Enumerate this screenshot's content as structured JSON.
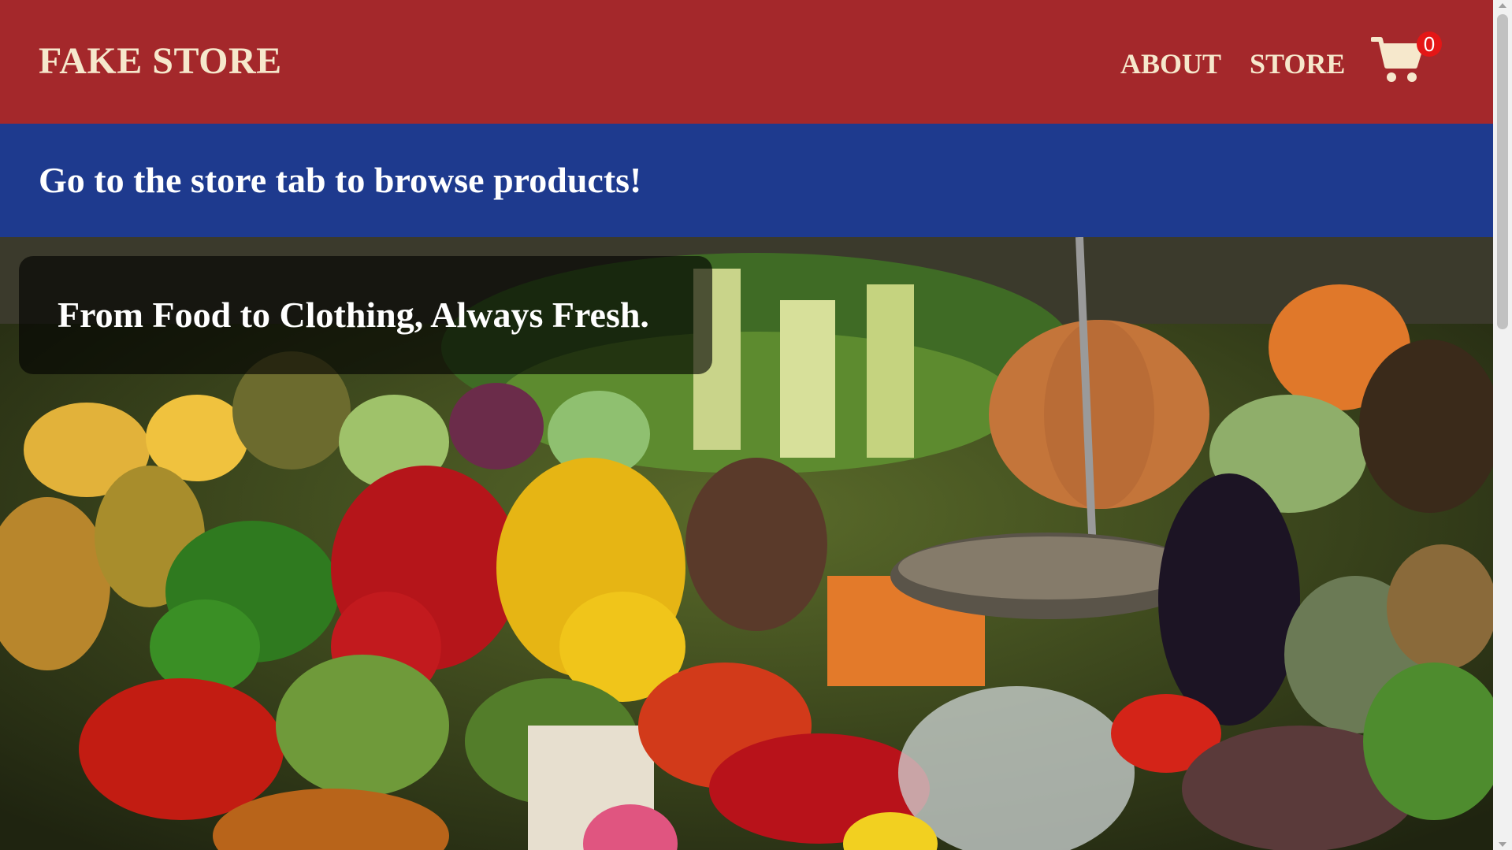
{
  "header": {
    "brand": "FAKE STORE",
    "nav": {
      "about_label": "ABOUT",
      "store_label": "STORE"
    },
    "cart": {
      "icon": "cart-icon",
      "count": "0"
    }
  },
  "banner": {
    "text": "Go to the store tab to browse products!"
  },
  "hero": {
    "image": "market-produce-stall-photo",
    "tagline": "From Food to Clothing, Always Fresh."
  },
  "colors": {
    "header_bg": "#a4282b",
    "header_text": "#f6e8cc",
    "banner_bg": "#1e3a8e",
    "banner_text": "#ffffff",
    "cart_badge": "#e41616"
  }
}
